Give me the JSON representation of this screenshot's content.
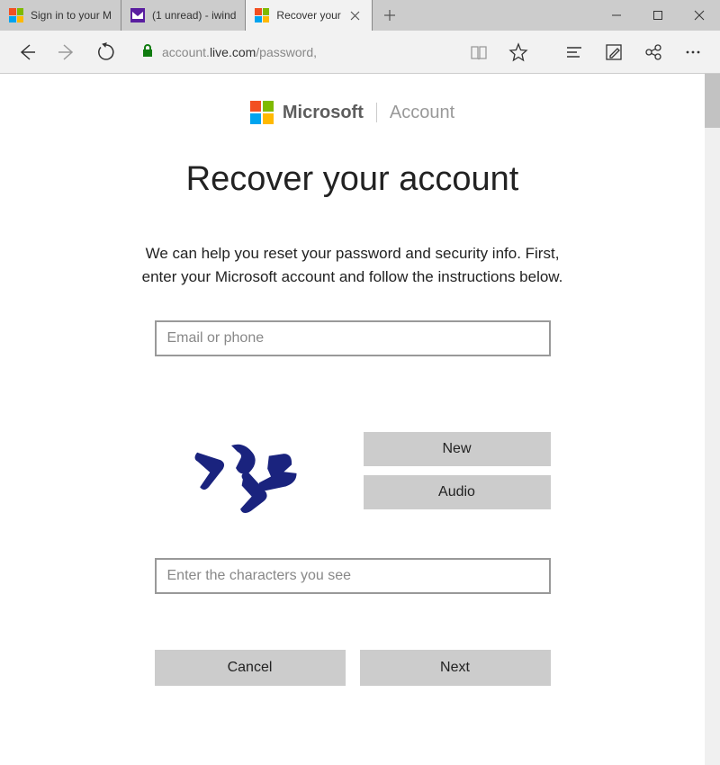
{
  "window": {
    "tabs": [
      {
        "title": "Sign in to your M"
      },
      {
        "title": "(1 unread) - iwind"
      },
      {
        "title": "Recover your",
        "active": true
      }
    ]
  },
  "address": {
    "pre": "account.",
    "host": "live.com",
    "post": "/password,"
  },
  "brand": {
    "name": "Microsoft",
    "section": "Account"
  },
  "main": {
    "title": "Recover your account",
    "description": "We can help you reset your password and security info. First, enter your Microsoft account and follow the instructions below.",
    "email_placeholder": "Email or phone",
    "captcha_placeholder": "Enter the characters you see",
    "captcha_new": "New",
    "captcha_audio": "Audio",
    "cancel": "Cancel",
    "next": "Next"
  }
}
